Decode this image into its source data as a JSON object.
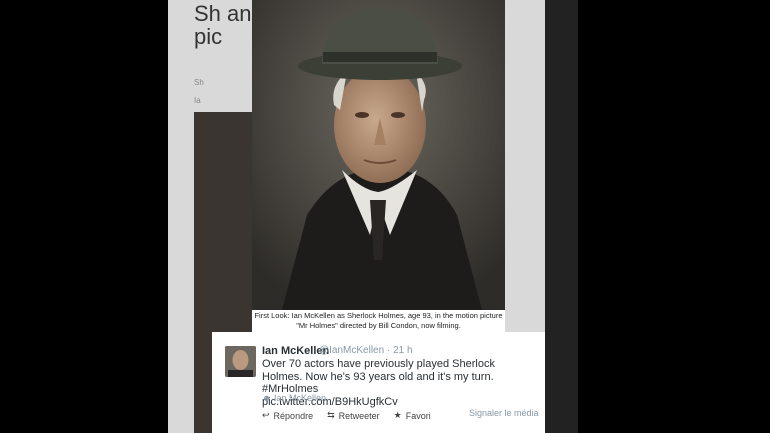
{
  "background_article": {
    "title": "Sh an pic",
    "meta_1": "Sh",
    "meta_2": "Ia"
  },
  "photo": {
    "caption": "First Look: Ian McKellen as Sherlock Holmes, age 93, in the motion picture \"Mr Holmes\" directed by Bill Condon, now filming."
  },
  "tweet": {
    "name": "Ian McKellen",
    "handle": "@IanMcKellen · 21 h",
    "text": "Over 70 actors have previously played Sherlock Holmes. Now he's 93 years old and it's my turn. #MrHolmes",
    "link": "pic.twitter.com/B9HkUgfkCv",
    "tagged": "Ian McKellen"
  },
  "actions": {
    "reply": "Répondre",
    "retweet": "Retweeter",
    "favorite": "Favori",
    "report": "Signaler le média"
  },
  "icons": {
    "reply": "reply-icon",
    "retweet": "retweet-icon",
    "favorite": "star-icon",
    "person": "person-icon"
  }
}
